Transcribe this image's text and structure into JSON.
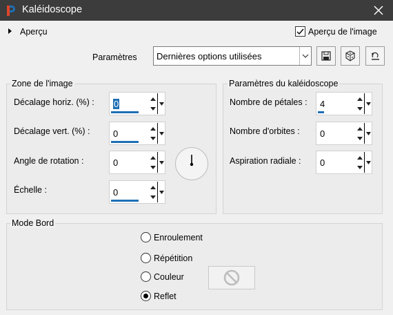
{
  "window": {
    "title": "Kaléidoscope"
  },
  "preview": {
    "toggle_label": "Aperçu",
    "checkbox_label": "Aperçu de l'image",
    "checkbox_checked": true
  },
  "presets": {
    "label": "Paramètres",
    "selected": "Dernières options utilisées"
  },
  "image_zone": {
    "title": "Zone de l'image",
    "fields": [
      {
        "label": "Décalage horiz. (%) :",
        "value": "0"
      },
      {
        "label": "Décalage vert. (%) :",
        "value": "0"
      },
      {
        "label": "Angle de rotation :",
        "value": "0"
      },
      {
        "label": "Échelle :",
        "value": "0"
      }
    ]
  },
  "kaleidoscope": {
    "title": "Paramètres du kaléidoscope",
    "fields": [
      {
        "label": "Nombre de pétales :",
        "value": "4"
      },
      {
        "label": "Nombre d'orbites :",
        "value": "0"
      },
      {
        "label": "Aspiration radiale :",
        "value": "0"
      }
    ]
  },
  "edge_mode": {
    "title": "Mode Bord",
    "options": [
      {
        "label": "Enroulement",
        "checked": false
      },
      {
        "label": "Répétition",
        "checked": false
      },
      {
        "label": "Couleur",
        "checked": false
      },
      {
        "label": "Reflet",
        "checked": true
      }
    ]
  },
  "colors": {
    "titlebar": "#3c3c3c",
    "accent": "#1e6fb5",
    "background": "#f0f0f0"
  },
  "icons": {
    "app": "paintshop-icon",
    "close": "close-icon",
    "save": "save-icon",
    "randomize": "dice-icon",
    "reset": "reset-icon",
    "no_color": "no-sign-icon"
  }
}
